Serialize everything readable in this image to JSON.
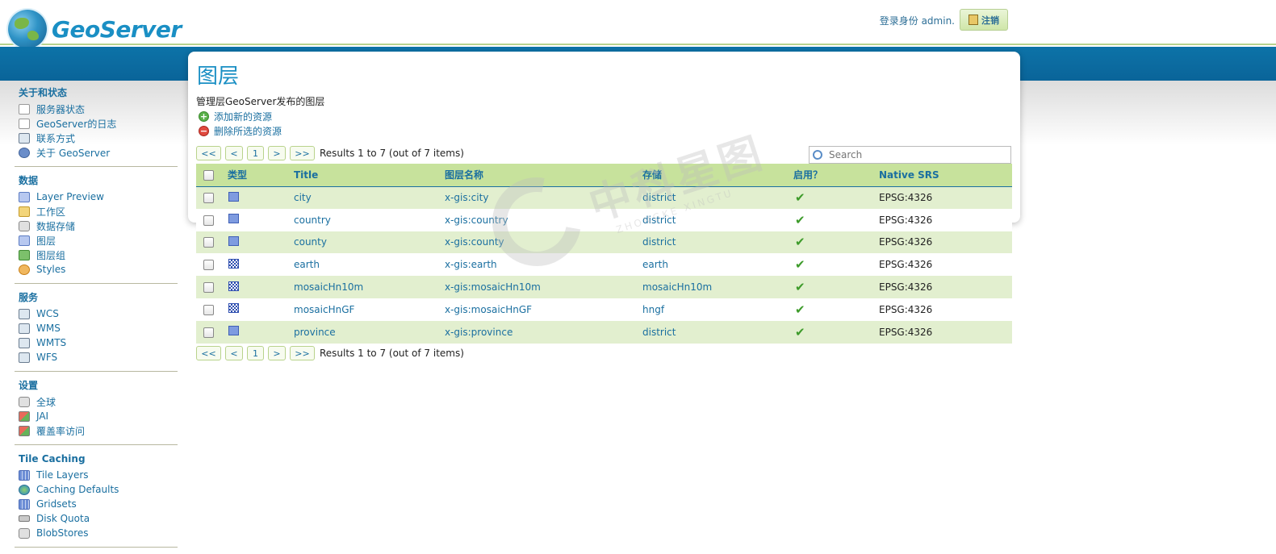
{
  "app": {
    "name": "GeoServer",
    "login_text": "登录身份 admin.",
    "logout_label": "注销"
  },
  "sidebar": {
    "groups": [
      {
        "title": "关于和状态",
        "items": [
          {
            "label": "服务器状态",
            "icon": "server-status-icon"
          },
          {
            "label": "GeoServer的日志",
            "icon": "log-icon"
          },
          {
            "label": "联系方式",
            "icon": "contact-icon"
          },
          {
            "label": "关于 GeoServer",
            "icon": "about-icon"
          }
        ]
      },
      {
        "title": "数据",
        "items": [
          {
            "label": "Layer Preview",
            "icon": "layer-preview-icon"
          },
          {
            "label": "工作区",
            "icon": "folder-icon"
          },
          {
            "label": "数据存储",
            "icon": "database-icon"
          },
          {
            "label": "图层",
            "icon": "layer-icon"
          },
          {
            "label": "图层组",
            "icon": "layer-group-icon"
          },
          {
            "label": "Styles",
            "icon": "styles-icon"
          }
        ]
      },
      {
        "title": "服务",
        "items": [
          {
            "label": "WCS",
            "icon": "service-icon"
          },
          {
            "label": "WMS",
            "icon": "service-icon"
          },
          {
            "label": "WMTS",
            "icon": "service-icon"
          },
          {
            "label": "WFS",
            "icon": "service-icon"
          }
        ]
      },
      {
        "title": "设置",
        "items": [
          {
            "label": "全球",
            "icon": "global-settings-icon"
          },
          {
            "label": "JAI",
            "icon": "jai-icon"
          },
          {
            "label": "覆盖率访问",
            "icon": "coverage-access-icon"
          }
        ]
      },
      {
        "title": "Tile Caching",
        "items": [
          {
            "label": "Tile Layers",
            "icon": "tile-layers-icon"
          },
          {
            "label": "Caching Defaults",
            "icon": "globe-icon"
          },
          {
            "label": "Gridsets",
            "icon": "gridsets-icon"
          },
          {
            "label": "Disk Quota",
            "icon": "disk-icon"
          },
          {
            "label": "BlobStores",
            "icon": "blobstore-icon"
          }
        ]
      }
    ]
  },
  "main": {
    "title": "图层",
    "description": "管理层GeoServer发布的图层",
    "add_label": "添加新的资源",
    "delete_label": "删除所选的资源",
    "search_placeholder": "Search",
    "pager": {
      "first": "<<",
      "prev": "<",
      "page": "1",
      "next": ">",
      "last": ">>",
      "info": "Results 1 to 7 (out of 7 items)"
    },
    "columns": [
      "类型",
      "Title",
      "图层名称",
      "存储",
      "启用？",
      "Native SRS"
    ],
    "rows": [
      {
        "type": "polygon",
        "title": "city",
        "name": "x-gis:city",
        "store": "district",
        "enabled": "✔",
        "srs": "EPSG:4326"
      },
      {
        "type": "polygon",
        "title": "country",
        "name": "x-gis:country",
        "store": "district",
        "enabled": "✔",
        "srs": "EPSG:4326"
      },
      {
        "type": "polygon",
        "title": "county",
        "name": "x-gis:county",
        "store": "district",
        "enabled": "✔",
        "srs": "EPSG:4326"
      },
      {
        "type": "raster",
        "title": "earth",
        "name": "x-gis:earth",
        "store": "earth",
        "enabled": "✔",
        "srs": "EPSG:4326"
      },
      {
        "type": "raster",
        "title": "mosaicHn10m",
        "name": "x-gis:mosaicHn10m",
        "store": "mosaicHn10m",
        "enabled": "✔",
        "srs": "EPSG:4326"
      },
      {
        "type": "raster",
        "title": "mosaicHnGF",
        "name": "x-gis:mosaicHnGF",
        "store": "hngf",
        "enabled": "✔",
        "srs": "EPSG:4326"
      },
      {
        "type": "polygon",
        "title": "province",
        "name": "x-gis:province",
        "store": "district",
        "enabled": "✔",
        "srs": "EPSG:4326"
      }
    ]
  },
  "watermark": {
    "text": "中科星图",
    "subtext": "ZHONGKE XINGTU"
  },
  "colors": {
    "accent": "#1a8fc4",
    "link": "#1a6fa0",
    "header_band": "#0d73a8",
    "table_header": "#c7e29c",
    "row_alt": "#e2efcf"
  }
}
